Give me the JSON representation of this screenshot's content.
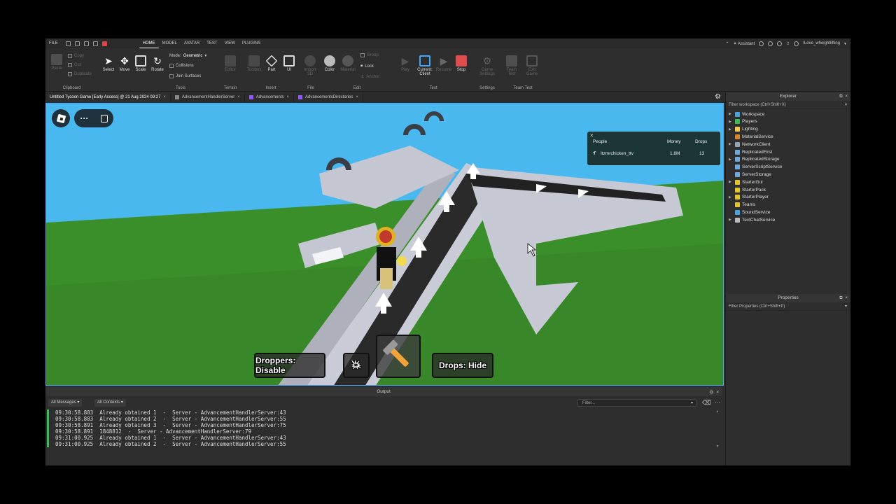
{
  "menubar": {
    "file": "FILE",
    "tabs": [
      "HOME",
      "MODEL",
      "AVATAR",
      "TEST",
      "VIEW",
      "PLUGINS"
    ],
    "active_tab": "HOME",
    "assistant": "Assistant",
    "username": "ILove_wheightlifting"
  },
  "ribbon": {
    "clipboard": {
      "label": "Clipboard",
      "paste": "Paste",
      "copy": "Copy",
      "cut": "Cut",
      "duplicate": "Duplicate"
    },
    "tools": {
      "label": "Tools",
      "select": "Select",
      "move": "Move",
      "scale": "Scale",
      "rotate": "Rotate",
      "mode_label": "Mode:",
      "mode_value": "Geometric",
      "collisions": "Collisions",
      "join_surfaces": "Join Surfaces"
    },
    "terrain": {
      "label": "Terrain",
      "editor": "Editor"
    },
    "insert": {
      "label": "Insert",
      "toolbox": "Toolbox",
      "part": "Part",
      "ui": "UI"
    },
    "file": {
      "label": "File",
      "import": "Import 3D"
    },
    "edit": {
      "label": "Edit",
      "color": "Color",
      "material": "Material",
      "group": "Group",
      "lock": "Lock",
      "anchor": "Anchor"
    },
    "test": {
      "label": "Test",
      "play": "Play",
      "current_client": "Current: Client",
      "resume": "Resume",
      "stop": "Stop"
    },
    "settings": {
      "label": "Settings",
      "game_settings": "Game Settings"
    },
    "team_test": {
      "label": "Team Test",
      "team_test_btn": "Team Test",
      "exit_game": "Exit Game"
    }
  },
  "doc_tabs": [
    {
      "label": "Untitled Tycoon Game [Early Access] @ 21 Aug 2024 09:27",
      "color": "#2e2e2e",
      "active": true
    },
    {
      "label": "AdvancementHandlerServer",
      "color": "#7a7a7a"
    },
    {
      "label": "Advancements",
      "color": "#8b5cf6"
    },
    {
      "label": "AdvancementsDirectories",
      "color": "#8b5cf6"
    }
  ],
  "leaderboard": {
    "headers": {
      "people": "People",
      "money": "Money",
      "drops": "Drops"
    },
    "rows": [
      {
        "name": "Itzmrchicken_ttv",
        "money": "1.8M",
        "drops": "13"
      }
    ]
  },
  "hud": {
    "droppers": "Droppers: Disable",
    "drops": "Drops: Hide"
  },
  "output": {
    "title": "Output",
    "filter_messages": "All Messages",
    "filter_contexts": "All Contexts",
    "filter_placeholder": "Filter...",
    "lines": [
      "09:30:58.883  Already obtained 1  -  Server - AdvancementHandlerServer:43",
      "09:30:58.883  Already obtained 2  -  Server - AdvancementHandlerServer:55",
      "09:30:58.891  Already obtained 3  -  Server - AdvancementHandlerServer:75",
      "09:30:58.891  1848812  -  Server - AdvancementHandlerServer:79",
      "09:31:00.925  Already obtained 1  -  Server - AdvancementHandlerServer:43",
      "09:31:00.925  Already obtained 2  -  Server - AdvancementHandlerServer:55"
    ]
  },
  "explorer": {
    "title": "Explorer",
    "filter": "Filter workspace (Ctrl+Shift+X)",
    "items": [
      {
        "label": "Workspace",
        "color": "#4aa3df",
        "expand": true
      },
      {
        "label": "Players",
        "color": "#3cba54",
        "expand": true
      },
      {
        "label": "Lighting",
        "color": "#f2c94c",
        "expand": true
      },
      {
        "label": "MaterialService",
        "color": "#d9822b",
        "expand": false
      },
      {
        "label": "NetworkClient",
        "color": "#8fa3b5",
        "expand": true
      },
      {
        "label": "ReplicatedFirst",
        "color": "#6fa8dc",
        "expand": false
      },
      {
        "label": "ReplicatedStorage",
        "color": "#6fa8dc",
        "expand": true
      },
      {
        "label": "ServerScriptService",
        "color": "#6fa8dc",
        "expand": false
      },
      {
        "label": "ServerStorage",
        "color": "#6fa8dc",
        "expand": false
      },
      {
        "label": "StarterGui",
        "color": "#e6c229",
        "expand": true
      },
      {
        "label": "StarterPack",
        "color": "#e6c229",
        "expand": false
      },
      {
        "label": "StarterPlayer",
        "color": "#e6c229",
        "expand": true
      },
      {
        "label": "Teams",
        "color": "#e6c229",
        "expand": false
      },
      {
        "label": "SoundService",
        "color": "#4aa3df",
        "expand": false
      },
      {
        "label": "TextChatService",
        "color": "#bbbbbb",
        "expand": true
      }
    ]
  },
  "properties": {
    "title": "Properties",
    "filter": "Filter Properties (Ctrl+Shift+P)"
  }
}
